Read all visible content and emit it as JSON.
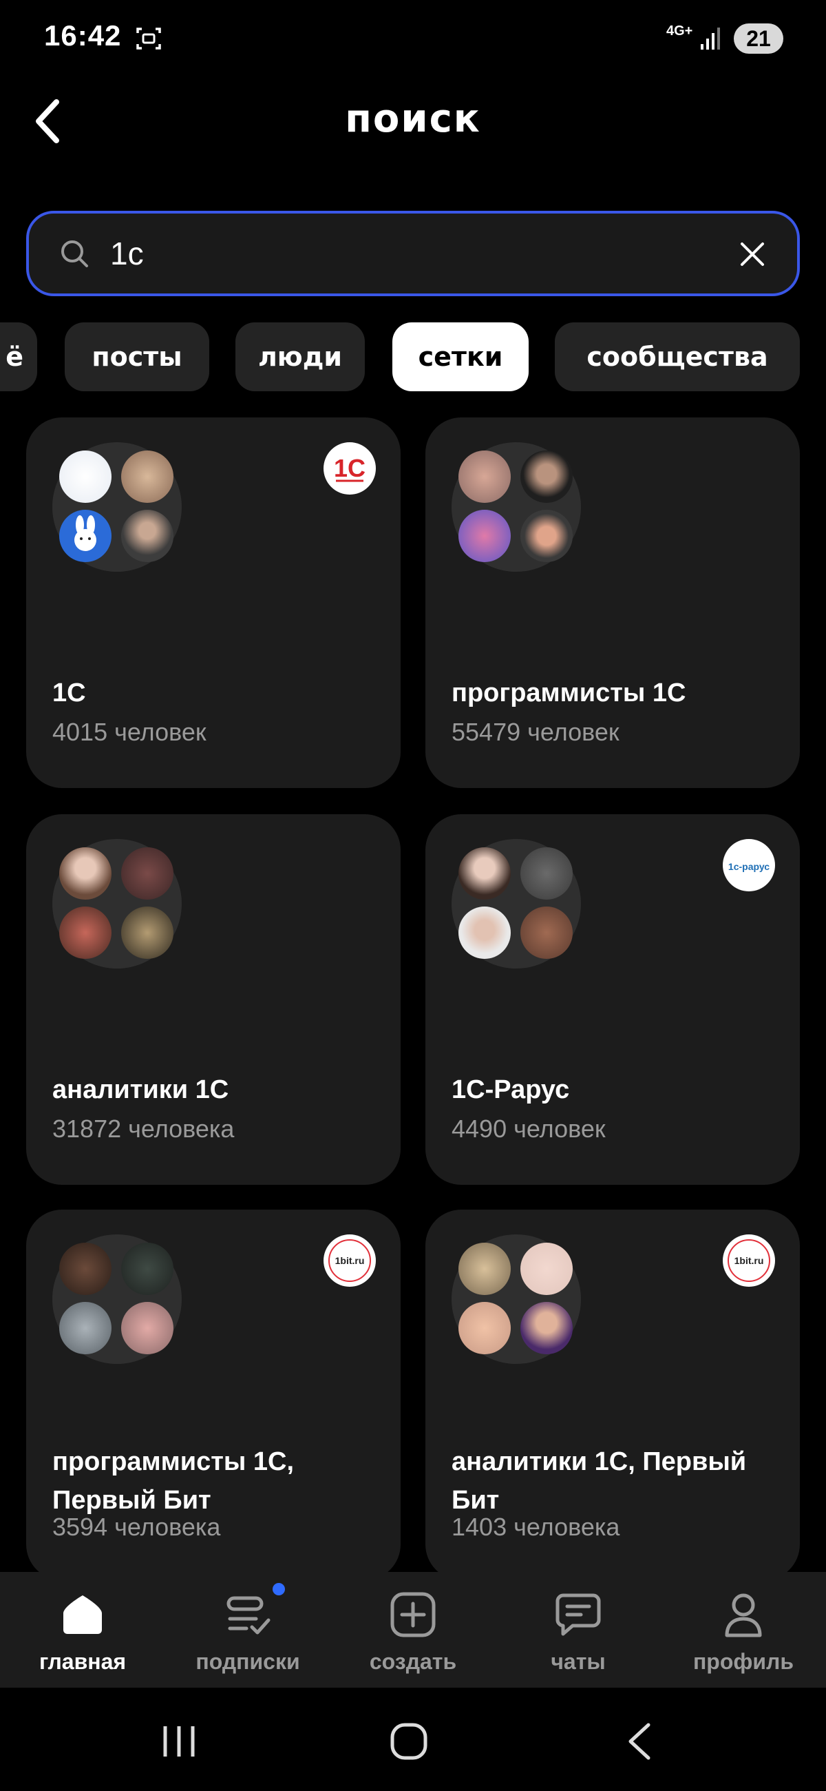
{
  "status_bar": {
    "time": "16:42",
    "network": "4G+",
    "battery": "21"
  },
  "header": {
    "title": "поиск"
  },
  "search": {
    "value": "1с",
    "placeholder": ""
  },
  "filters": [
    {
      "label": "ё",
      "active": false
    },
    {
      "label": "посты",
      "active": false
    },
    {
      "label": "люди",
      "active": false
    },
    {
      "label": "сетки",
      "active": true
    },
    {
      "label": "сообщества",
      "active": false
    }
  ],
  "cards": [
    {
      "title": "1С",
      "count": "4015 человек",
      "logo": "1c-logo"
    },
    {
      "title": "программисты 1С",
      "count": "55479 человек",
      "logo": ""
    },
    {
      "title": "аналитики 1С",
      "count": "31872 человека",
      "logo": ""
    },
    {
      "title": "1С-Рарус",
      "count": "4490 человек",
      "logo": "1c-rarus-logo",
      "logo_text": "1с-рарус"
    },
    {
      "title": "программисты 1С, Первый Бит",
      "count": "3594 человека",
      "logo": "1bit-logo",
      "logo_text": "1bit.ru"
    },
    {
      "title": "аналитики 1С, Первый Бит",
      "count": "1403 человека",
      "logo": "1bit-logo",
      "logo_text": "1bit.ru"
    }
  ],
  "bottom_nav": [
    {
      "label": "главная",
      "icon": "home-icon",
      "active": true
    },
    {
      "label": "подписки",
      "icon": "subscriptions-icon",
      "active": false,
      "badge": true
    },
    {
      "label": "создать",
      "icon": "create-icon",
      "active": false
    },
    {
      "label": "чаты",
      "icon": "chat-icon",
      "active": false
    },
    {
      "label": "профиль",
      "icon": "profile-icon",
      "active": false
    }
  ],
  "colors": {
    "accent": "#3a57e8",
    "card_bg": "#1c1c1c",
    "chip_bg": "#242424",
    "badge": "#2f6bff"
  }
}
